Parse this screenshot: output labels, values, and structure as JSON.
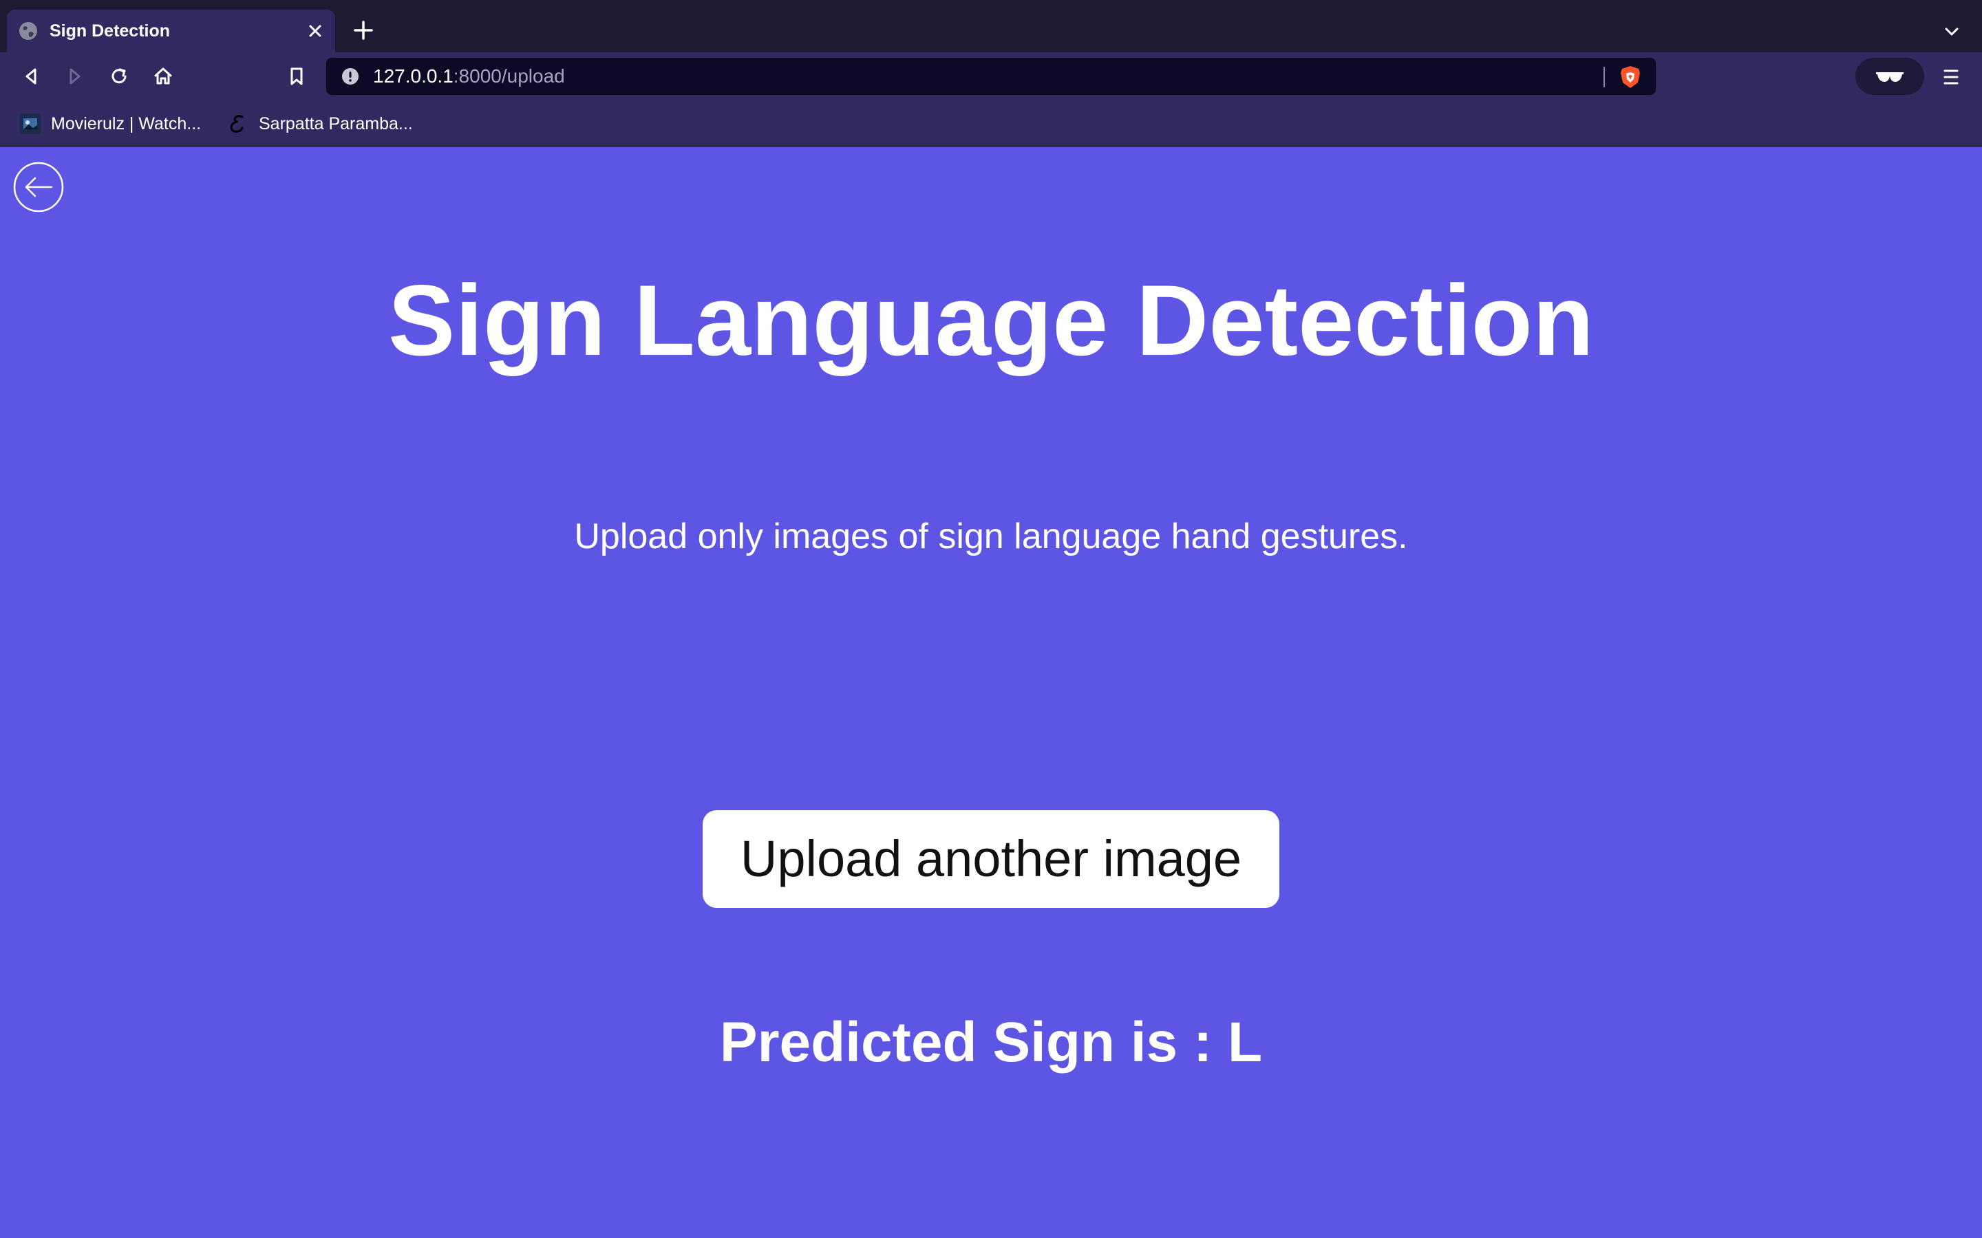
{
  "browser": {
    "tab": {
      "title": "Sign Detection",
      "favicon": "globe-icon"
    },
    "address_bar": {
      "host": "127.0.0.1",
      "path": ":8000/upload"
    },
    "bookmarks": [
      {
        "label": "Movierulz | Watch...",
        "icon": "movierulz-favicon"
      },
      {
        "label": "Sarpatta Paramba...",
        "icon": "script-e-favicon"
      }
    ],
    "colors": {
      "tabbar": "#1c1b31",
      "toolbar": "#302a60",
      "address_bar": "#0d0a26",
      "brave_orange": "#fb542b"
    }
  },
  "page": {
    "title": "Sign Language Detection",
    "subtitle": "Upload only images of sign language hand gestures.",
    "upload_button_label": "Upload another image",
    "prediction": "Predicted Sign is : L",
    "colors": {
      "background": "#5d55e3",
      "text": "#ffffff",
      "button_bg": "#ffffff",
      "button_text": "#111111"
    }
  }
}
